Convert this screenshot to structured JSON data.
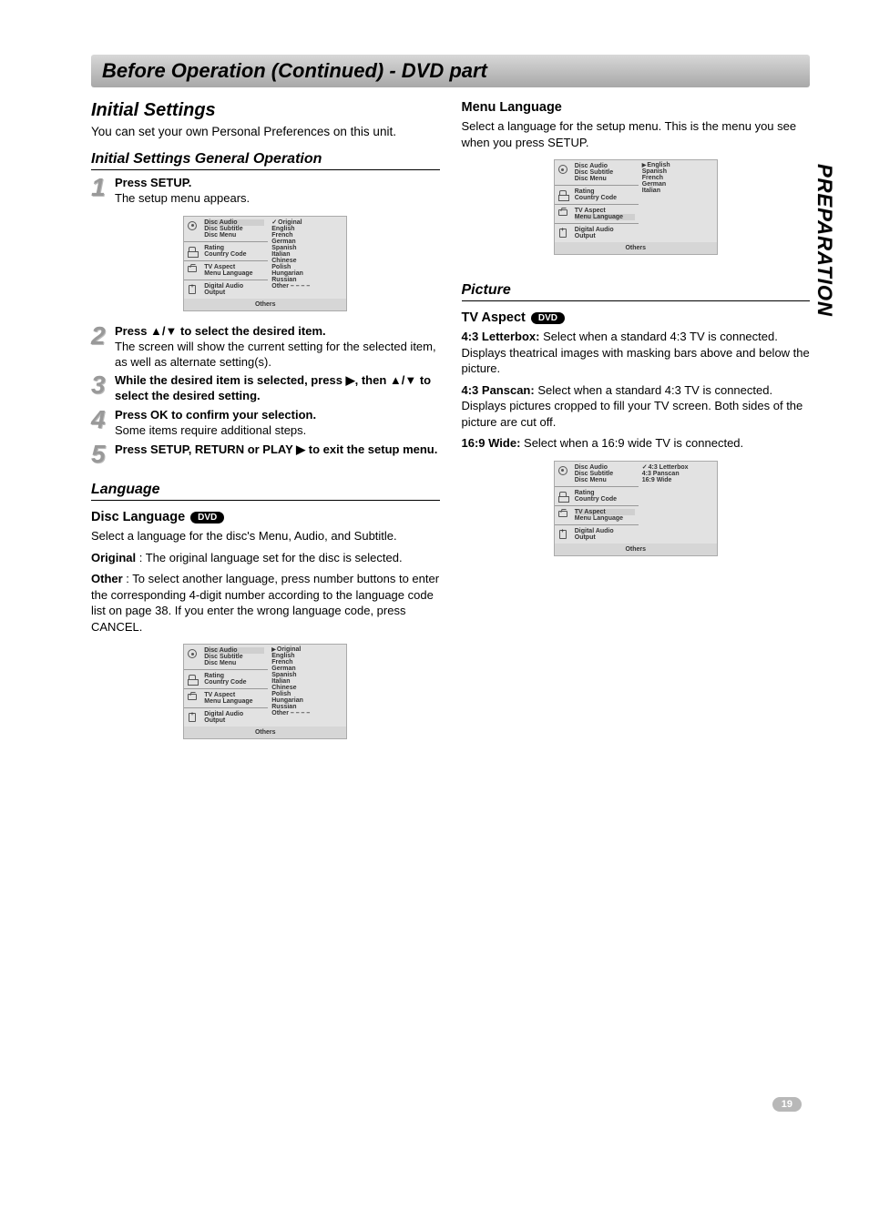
{
  "sideTab": "PREPARATION",
  "pageNumber": "19",
  "titleBar": "Before Operation (Continued) - DVD part",
  "left": {
    "heading": "Initial Settings",
    "intro": "You can set your own Personal Preferences on this unit.",
    "subHeading": "Initial Settings General Operation",
    "steps": {
      "s1b": "Press SETUP.",
      "s1t": "The setup menu appears.",
      "s2b": "Press ▲/▼ to select the desired item.",
      "s2t": "The screen will show the current setting for the selected item, as well as alternate setting(s).",
      "s3b": "While the desired item is selected, press ▶, then ▲/▼ to select the desired setting.",
      "s4b": "Press OK to confirm your selection.",
      "s4t": "Some items require additional steps.",
      "s5b": "Press SETUP, RETURN or PLAY ▶ to exit the setup menu."
    },
    "languageHeading": "Language",
    "discLangTitle": "Disc Language",
    "dvdBadge": "DVD",
    "discLangText": "Select a language for the disc's Menu, Audio, and Subtitle.",
    "originalLabel": "Original",
    "originalDesc": " : The original language set for the disc is selected.",
    "otherLabel": "Other",
    "otherDesc": " : To select another language, press number buttons to enter the corresponding 4-digit number according to the language code list on page 38. If you enter the wrong language code, press CANCEL.",
    "menu1": {
      "groups": [
        {
          "icon": "disc",
          "labels": [
            "Disc Audio",
            "Disc Subtitle",
            "Disc Menu"
          ],
          "highlight": 0
        },
        {
          "icon": "lock",
          "labels": [
            "Rating",
            "Country Code"
          ]
        },
        {
          "icon": "tv",
          "labels": [
            "TV Aspect",
            "Menu Language"
          ]
        },
        {
          "icon": "aud",
          "labels": [
            "Digital Audio Output"
          ]
        }
      ],
      "values": [
        "Original",
        "English",
        "French",
        "German",
        "Spanish",
        "Italian",
        "Chinese",
        "Polish",
        "Hungarian",
        "Russian",
        "Other  – – – –"
      ],
      "valueMark": "chk",
      "others": "Others"
    },
    "menu2": {
      "groups": [
        {
          "icon": "disc",
          "labels": [
            "Disc Audio",
            "Disc Subtitle",
            "Disc Menu"
          ],
          "highlight": 0
        },
        {
          "icon": "lock",
          "labels": [
            "Rating",
            "Country Code"
          ]
        },
        {
          "icon": "tv",
          "labels": [
            "TV Aspect",
            "Menu Language"
          ]
        },
        {
          "icon": "aud",
          "labels": [
            "Digital Audio Output"
          ]
        }
      ],
      "values": [
        "Original",
        "English",
        "French",
        "German",
        "Spanish",
        "Italian",
        "Chinese",
        "Polish",
        "Hungarian",
        "Russian",
        "Other  – – – –"
      ],
      "valueMark": "sel",
      "others": "Others"
    }
  },
  "right": {
    "menuLangTitle": "Menu Language",
    "menuLangText": "Select a language for the setup menu. This is the menu you see when you press SETUP.",
    "pictureHeading": "Picture",
    "tvAspectTitle": "TV Aspect",
    "tvAspect1Label": "4:3 Letterbox:",
    "tvAspect1Desc": " Select when a standard 4:3 TV is connected. Displays theatrical images with masking bars above and below the picture.",
    "tvAspect2Label": "4:3 Panscan:",
    "tvAspect2Desc": " Select when a standard 4:3 TV is connected. Displays pictures cropped to fill your TV screen. Both sides of the picture are cut off.",
    "tvAspect3Label": "16:9 Wide:",
    "tvAspect3Desc": " Select when a 16:9 wide TV is connected.",
    "menu3": {
      "groups": [
        {
          "icon": "disc",
          "labels": [
            "Disc Audio",
            "Disc Subtitle",
            "Disc Menu"
          ]
        },
        {
          "icon": "lock",
          "labels": [
            "Rating",
            "Country Code"
          ]
        },
        {
          "icon": "tv",
          "labels": [
            "TV Aspect",
            "Menu Language"
          ],
          "highlight": 1
        },
        {
          "icon": "aud",
          "labels": [
            "Digital Audio Output"
          ]
        }
      ],
      "values": [
        "English",
        "Spanish",
        "French",
        "German",
        "Italian"
      ],
      "valueMark": "sel",
      "others": "Others"
    },
    "menu4": {
      "groups": [
        {
          "icon": "disc",
          "labels": [
            "Disc Audio",
            "Disc Subtitle",
            "Disc Menu"
          ]
        },
        {
          "icon": "lock",
          "labels": [
            "Rating",
            "Country Code"
          ]
        },
        {
          "icon": "tv",
          "labels": [
            "TV Aspect",
            "Menu Language"
          ],
          "highlight": 0
        },
        {
          "icon": "aud",
          "labels": [
            "Digital Audio Output"
          ]
        }
      ],
      "values": [
        "4:3 Letterbox",
        "4:3 Panscan",
        "16:9 Wide"
      ],
      "valueMark": "chk",
      "others": "Others"
    }
  }
}
